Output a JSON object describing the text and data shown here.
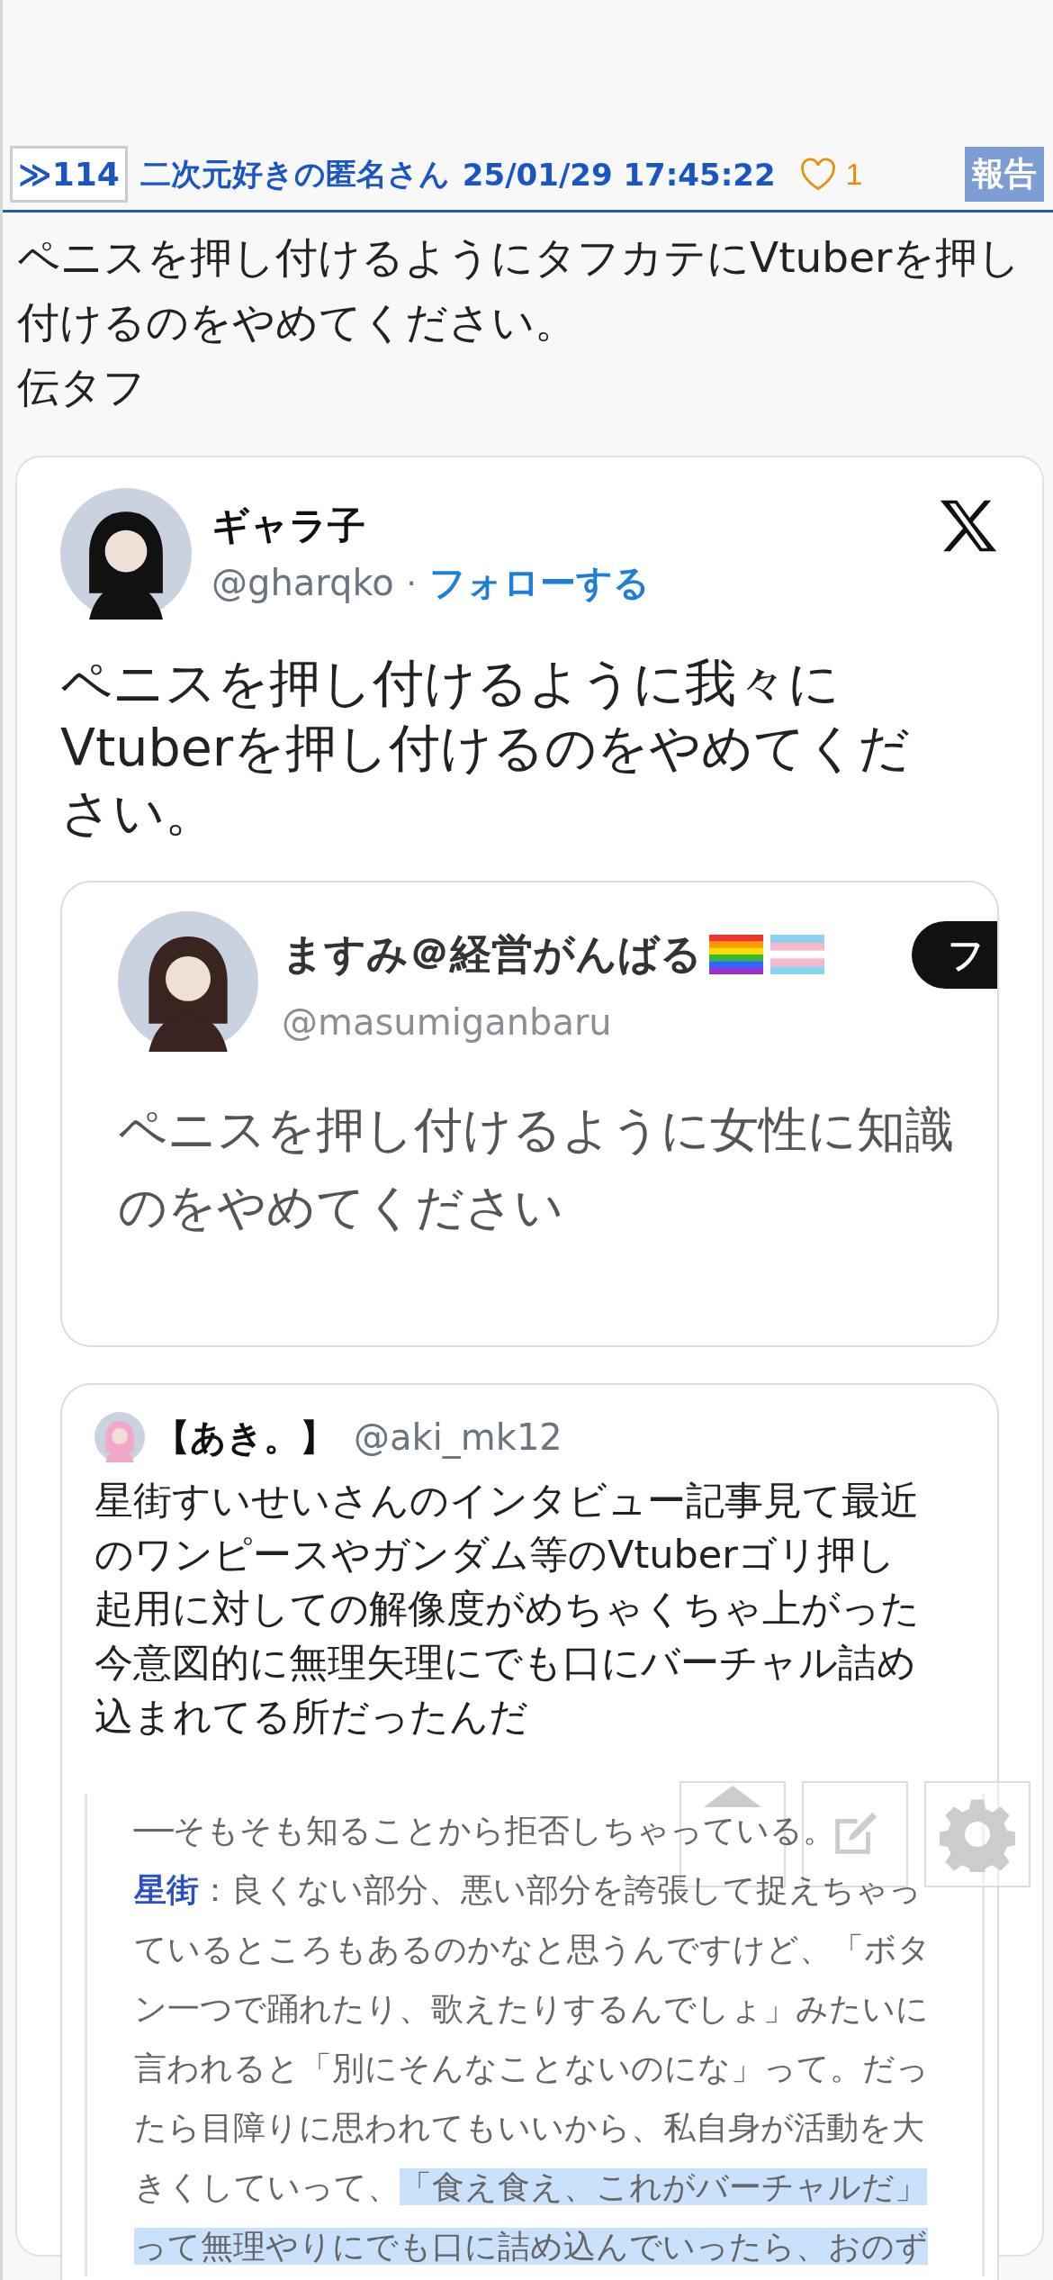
{
  "post": {
    "number": "≫114",
    "author": "二次元好きの匿名さん",
    "timestamp": "25/01/29 17:45:22",
    "likes": "1",
    "liked": false,
    "report": "報告",
    "body": "ペニスを押し付けるようにタフカテにVtuberを押し付けるのをやめてください。",
    "signature": "伝タフ"
  },
  "tweet": {
    "name": "ギャラ子",
    "handle": "@gharqko",
    "separator": "·",
    "follow": "フォローする",
    "text": "ペニスを押し付けるように我々にVtuberを押し付けるのをやめてください。",
    "quoted_image": {
      "name": "ますみ＠経営がんばる",
      "flags": [
        {
          "kind": "rainbow"
        },
        {
          "kind": "trans"
        }
      ],
      "follow": "フ",
      "handle": "@masumiganbaru",
      "lines": [
        "ペニスを押し付けるように女性に知識",
        "のをやめてください"
      ]
    },
    "quoted_tweet": {
      "name": "【あき。】",
      "handle": "@aki_mk12",
      "paragraphs": [
        "星街すいせいさんのインタビュー記事見て最近のワンピースやガンダム等のVtuberゴリ押し起用に対しての解像度がめちゃくちゃ上がった",
        "今意図的に無理矢理にでも口にバーチャル詰め込まれてる所だったんだ"
      ],
      "article": [
        {
          "segments": [
            {
              "kind": "plain",
              "text": "──そもそも知ることから拒否しちゃっている。",
              "selected": false
            }
          ]
        },
        {
          "segments": [
            {
              "kind": "speaker",
              "text": "星街",
              "selected": false
            },
            {
              "kind": "plain",
              "text": "：良くない部分、悪い部分を誇張して捉えちゃっ",
              "selected": false
            }
          ]
        },
        {
          "segments": [
            {
              "kind": "plain",
              "text": "ているところもあるのかなと思うんですけど、「ボタ",
              "selected": false
            }
          ]
        },
        {
          "segments": [
            {
              "kind": "plain",
              "text": "ン一つで踊れたり、歌えたりするんでしょ」みたいに",
              "selected": false
            }
          ]
        },
        {
          "segments": [
            {
              "kind": "plain",
              "text": "言われると「別にそんなことないのにな」って。だっ",
              "selected": false
            }
          ]
        },
        {
          "segments": [
            {
              "kind": "plain",
              "text": "たら目障りに思われてもいいから、私自身が活動を大",
              "selected": false
            }
          ]
        },
        {
          "segments": [
            {
              "kind": "plain",
              "text": "きくしていって、",
              "selected": false
            },
            {
              "kind": "plain",
              "text": "「食え食え、これがバーチャルだ」",
              "selected": true
            }
          ]
        },
        {
          "segments": [
            {
              "kind": "plain",
              "text": "って無理やりにでも口に詰め込んでいったら、おのず",
              "selected": true
            }
          ]
        }
      ]
    }
  }
}
